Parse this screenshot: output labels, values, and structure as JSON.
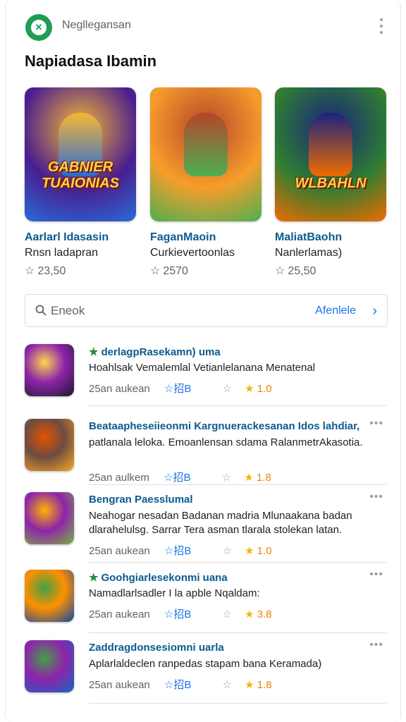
{
  "header": {
    "app_name": "Negllegansan",
    "section_title": "Napiadasa Ibamin",
    "logo_icon": "app-logo-icon",
    "brand_color": "#1f9d55"
  },
  "featured": [
    {
      "title": "Aarlarl Idasasin",
      "subtitle": "Rnsn ladapran",
      "rating": "23,50",
      "logo_text": "GABNIER TUAIONIAS",
      "colors": [
        "#4a1d8f",
        "#2a6ad8",
        "#f7b733"
      ]
    },
    {
      "title": "FaganMaoin",
      "subtitle": "Curkievertoonlas",
      "rating": "2570",
      "logo_text": "",
      "colors": [
        "#f79d2b",
        "#4caf50",
        "#b5452a"
      ]
    },
    {
      "title": "MaliatBaohn",
      "subtitle": "Nanlerlamas)",
      "rating": "25,50",
      "logo_text": "WLBAHLN",
      "colors": [
        "#2e7d32",
        "#ef6c00",
        "#1a237e"
      ]
    }
  ],
  "search": {
    "placeholder": "Eneok",
    "action_label": "Afenlele"
  },
  "list": [
    {
      "title": "derlagpRasekamn) uma",
      "green_star": true,
      "desc": "Hoahlsak Vemalemlal Vetianlelanana Menatenal",
      "meta": "25an aukean",
      "tag": "☆招B",
      "score": "1.0",
      "more": false,
      "colors": [
        "#1a1a2e",
        "#8e24aa",
        "#ffd54f"
      ]
    },
    {
      "title": "Beataapheseiieonmi Kargnuerackesanan Idos lahdiar,",
      "green_star": false,
      "desc": "patlanala leloka. Emoanlensan sdama RalanmetrAkasotia.",
      "meta": "25an aulkem",
      "tag": "☆招B",
      "score": "1.8",
      "more": true,
      "colors": [
        "#f9a825",
        "#6d4c41",
        "#e65100"
      ]
    },
    {
      "title": "Bengran Paesslumal",
      "green_star": false,
      "desc": "Neahogar nesadan Badanan madria Mlunaakana badan dlarahelulsg. Sarrar Tera asman tlarala stolekan latan.",
      "meta": "25an aukean",
      "tag": "☆招B",
      "score": "1.0",
      "more": true,
      "colors": [
        "#7cb342",
        "#8e24aa",
        "#ffb300"
      ]
    },
    {
      "title": "Goohgiarlesekonmi uana",
      "green_star": true,
      "desc": "Namadlarlsadler I la apble Nqaldam:",
      "meta": "25an aukean",
      "tag": "☆招B",
      "score": "3.8",
      "more": true,
      "colors": [
        "#0d47a1",
        "#ff8f00",
        "#43a047"
      ]
    },
    {
      "title": "Zaddragdonsesiomni uarla",
      "green_star": false,
      "desc": "Aplarlaldeclen ranpedas stapam bana Keramada)",
      "meta": "25an aukean",
      "tag": "☆招B",
      "score": "1.8",
      "more": true,
      "colors": [
        "#1565c0",
        "#8e24aa",
        "#43a047"
      ]
    }
  ]
}
